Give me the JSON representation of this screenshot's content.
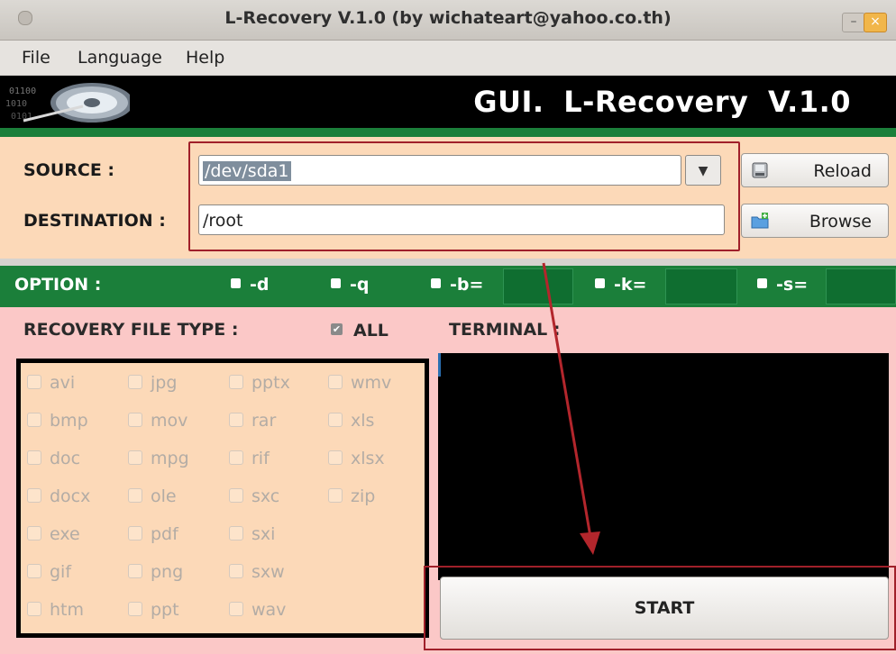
{
  "window": {
    "title": "L-Recovery V.1.0 (by wichateart@yahoo.co.th)",
    "minimize_glyph": "–",
    "close_glyph": "×"
  },
  "menu": [
    "File",
    "Language",
    "Help"
  ],
  "banner": {
    "title": "GUI.  L-Recovery V.1.0",
    "logo_icon": "hard-disk-icon"
  },
  "source": {
    "label": "SOURCE :",
    "value": "/dev/sda1",
    "dropdown_glyph": "▼",
    "reload_label": "Reload",
    "reload_icon": "disk-reload-icon"
  },
  "destination": {
    "label": "DESTINATION :",
    "value": "/root",
    "browse_label": "Browse",
    "browse_icon": "folder-add-icon"
  },
  "options": {
    "label": "OPTION :",
    "flags": [
      "-d",
      "-q",
      "-b=",
      "-k=",
      "-s="
    ],
    "values": {
      "b": "",
      "k": "",
      "s": ""
    }
  },
  "recovery": {
    "label": "RECOVERY FILE TYPE :",
    "all_label": "ALL",
    "all_checked": true,
    "columns": [
      [
        "avi",
        "bmp",
        "doc",
        "docx",
        "exe",
        "gif",
        "htm"
      ],
      [
        "jpg",
        "mov",
        "mpg",
        "ole",
        "pdf",
        "png",
        "ppt"
      ],
      [
        "pptx",
        "rar",
        "rif",
        "sxc",
        "sxi",
        "sxw",
        "wav"
      ],
      [
        "wmv",
        "xls",
        "xlsx",
        "zip"
      ]
    ]
  },
  "terminal": {
    "label": "TERMINAL :",
    "output": ""
  },
  "start": {
    "label": "START"
  },
  "colors": {
    "panel_peach": "#fcd9b8",
    "option_green": "#1b7f3a",
    "lower_pink": "#fbc8c7",
    "annotation_red": "#a0202a"
  }
}
